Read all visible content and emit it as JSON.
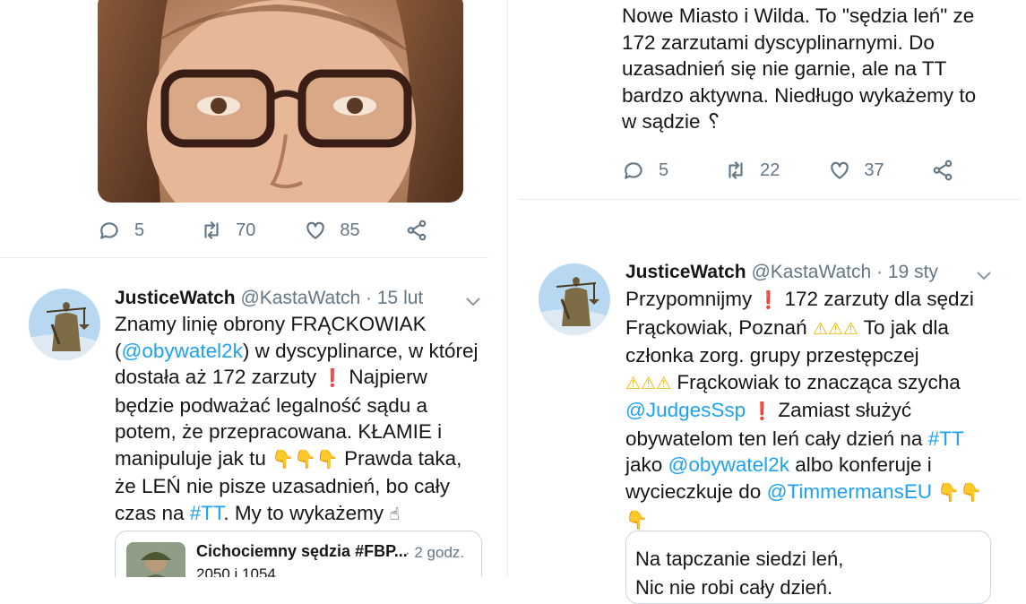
{
  "left_column": {
    "top_tweet": {
      "stats": {
        "replies": "5",
        "retweets": "70",
        "likes": "85"
      }
    },
    "tweet": {
      "display_name": "JusticeWatch",
      "handle": "@KastaWatch",
      "time": "· 15 lut",
      "lines": [
        [
          {
            "t": "Znamy linię obrony FRĄCKOWIAK"
          }
        ],
        [
          {
            "t": "("
          },
          {
            "t": "@obywatel2k",
            "link": true
          },
          {
            "t": ") w dyscyplinarce, w której"
          }
        ],
        [
          {
            "t": "dostała aż 172 zarzuty "
          },
          {
            "t": "❗",
            "emoji": true
          },
          {
            "t": " Najpierw"
          }
        ],
        [
          {
            "t": "będzie podważać legalność sądu a"
          }
        ],
        [
          {
            "t": "potem, że  przepracowana. KŁAMIE i"
          }
        ],
        [
          {
            "t": "manipuluje jak tu "
          },
          {
            "t": "👇👇👇",
            "point": true
          },
          {
            "t": " Prawda taka,"
          }
        ],
        [
          {
            "t": "że LEŃ nie pisze uzasadnień, bo cały"
          }
        ],
        [
          {
            "t": "czas na "
          },
          {
            "t": "#TT",
            "link": true
          },
          {
            "t": ". My to wykażemy "
          },
          {
            "t": "☝",
            "emoji": true
          }
        ]
      ],
      "quote": {
        "name": "Cichociemny sędzia #FBP...",
        "time": "· 2 godz.",
        "text": "2050 i 1054"
      }
    }
  },
  "right_column": {
    "top_tweet": {
      "lines": [
        "Nowe Miasto i Wilda. To \"sędzia leń\" ze",
        "172 zarzutami dyscyplinarnymi. Do",
        "uzasadnień się nie garnie, ale na TT",
        "bardzo aktywna. Niedługo wykażemy to",
        "w sądzie ␦"
      ],
      "stats": {
        "replies": "5",
        "retweets": "22",
        "likes": "37"
      }
    },
    "tweet": {
      "display_name": "JusticeWatch",
      "handle": "@KastaWatch",
      "time": "· 19 sty",
      "lines": [
        [
          {
            "t": "Przypomnijmy "
          },
          {
            "t": "❗",
            "emoji": true
          },
          {
            "t": " 172 zarzuty dla sędzi"
          }
        ],
        [
          {
            "t": "Frąckowiak, Poznań "
          },
          {
            "t": "⚠⚠⚠",
            "emoji": true,
            "warn": true
          },
          {
            "t": " To jak dla"
          }
        ],
        [
          {
            "t": "członka zorg. grupy przestępczej"
          }
        ],
        [
          {
            "t": "⚠⚠⚠",
            "emoji": true,
            "warn": true
          },
          {
            "t": " Frąckowiak to znacząca szycha"
          }
        ],
        [
          {
            "t": "@JudgesSsp",
            "link": true
          },
          {
            "t": " "
          },
          {
            "t": "❗",
            "emoji": true
          },
          {
            "t": " Zamiast służyć"
          }
        ],
        [
          {
            "t": "obywatelom ten leń cały dzień na "
          },
          {
            "t": "#TT",
            "link": true
          }
        ],
        [
          {
            "t": "jako "
          },
          {
            "t": "@obywatel2k",
            "link": true
          },
          {
            "t": " albo konferuje i"
          }
        ],
        [
          {
            "t": "wycieczkuje do "
          },
          {
            "t": "@TimmermansEU",
            "link": true
          },
          {
            "t": " "
          },
          {
            "t": "👇👇",
            "point": true
          }
        ],
        [
          {
            "t": "👇",
            "point": true
          }
        ]
      ],
      "quote_card": {
        "line1": "Na tapczanie siedzi leń,",
        "line2": "Nic nie robi cały dzień."
      }
    }
  },
  "colors": {
    "link": "#1da1f2",
    "meta": "#657786",
    "divider": "#e6ecf0"
  },
  "icons": [
    "reply-icon",
    "retweet-icon",
    "like-icon",
    "share-icon",
    "chevron-down-icon"
  ]
}
